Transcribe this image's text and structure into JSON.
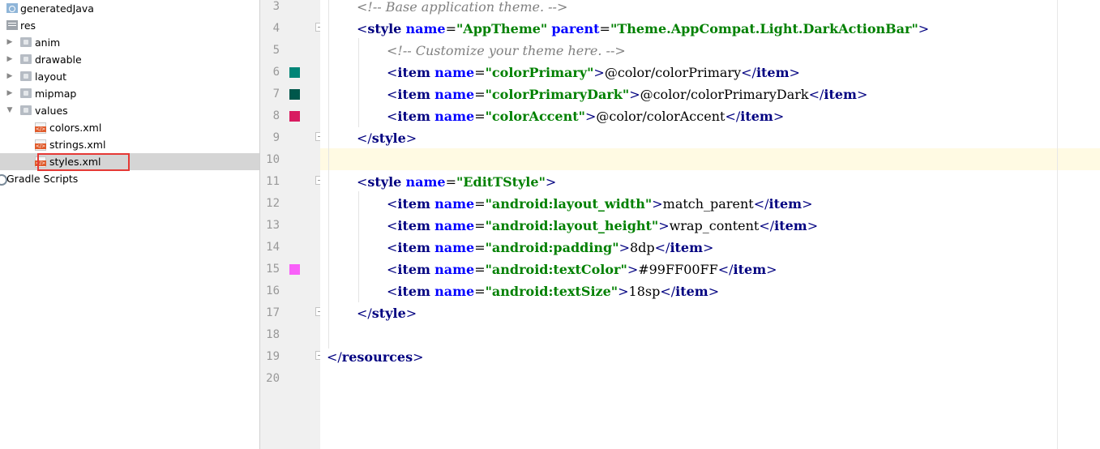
{
  "tree": {
    "items": [
      {
        "label": "generatedJava",
        "icon": "generated-java-icon"
      },
      {
        "label": "res",
        "icon": "res-folder-icon"
      },
      {
        "label": "anim",
        "icon": "folder-icon"
      },
      {
        "label": "drawable",
        "icon": "folder-icon"
      },
      {
        "label": "layout",
        "icon": "folder-icon"
      },
      {
        "label": "mipmap",
        "icon": "folder-icon"
      },
      {
        "label": "values",
        "icon": "folder-icon"
      },
      {
        "label": "colors.xml",
        "icon": "xml-file-icon"
      },
      {
        "label": "strings.xml",
        "icon": "xml-file-icon"
      },
      {
        "label": "styles.xml",
        "icon": "xml-file-icon",
        "selected": true
      },
      {
        "label": "Gradle Scripts",
        "icon": "gradle-icon"
      }
    ]
  },
  "gutter": {
    "line_numbers": [
      "3",
      "4",
      "5",
      "6",
      "7",
      "8",
      "9",
      "10",
      "11",
      "12",
      "13",
      "14",
      "15",
      "16",
      "17",
      "18",
      "19",
      "20"
    ],
    "swatches": [
      {
        "line": "6",
        "color": "#008577"
      },
      {
        "line": "7",
        "color": "#00574B"
      },
      {
        "line": "8",
        "color": "#D81B60"
      },
      {
        "line": "15",
        "color": "#FF00FF",
        "alpha": 0.6
      }
    ]
  },
  "editor": {
    "current_line": "10",
    "colors": {
      "tag": "#000080",
      "attr": "#0000FF",
      "value": "#008000",
      "comment": "#808080"
    },
    "lines": [
      {
        "n": "3",
        "indent": 1,
        "tokens": [
          [
            "cmt",
            "<!-- Base application theme. -->"
          ]
        ]
      },
      {
        "n": "4",
        "indent": 1,
        "tokens": [
          [
            "tag",
            "<"
          ],
          [
            "tname",
            "style"
          ],
          [
            "txt",
            " "
          ],
          [
            "attr",
            "name"
          ],
          [
            "txt",
            "="
          ],
          [
            "val",
            "\"AppTheme\""
          ],
          [
            "txt",
            " "
          ],
          [
            "attr",
            "parent"
          ],
          [
            "txt",
            "="
          ],
          [
            "val",
            "\"Theme.AppCompat.Light.DarkActionBar\""
          ],
          [
            "tag",
            ">"
          ]
        ]
      },
      {
        "n": "5",
        "indent": 2,
        "tokens": [
          [
            "cmt",
            "<!-- Customize your theme here. -->"
          ]
        ]
      },
      {
        "n": "6",
        "indent": 2,
        "tokens": [
          [
            "tag",
            "<"
          ],
          [
            "tname",
            "item"
          ],
          [
            "txt",
            " "
          ],
          [
            "attr",
            "name"
          ],
          [
            "txt",
            "="
          ],
          [
            "val",
            "\"colorPrimary\""
          ],
          [
            "tag",
            ">"
          ],
          [
            "txt",
            "@color/colorPrimary"
          ],
          [
            "tag",
            "</"
          ],
          [
            "tname",
            "item"
          ],
          [
            "tag",
            ">"
          ]
        ]
      },
      {
        "n": "7",
        "indent": 2,
        "tokens": [
          [
            "tag",
            "<"
          ],
          [
            "tname",
            "item"
          ],
          [
            "txt",
            " "
          ],
          [
            "attr",
            "name"
          ],
          [
            "txt",
            "="
          ],
          [
            "val",
            "\"colorPrimaryDark\""
          ],
          [
            "tag",
            ">"
          ],
          [
            "txt",
            "@color/colorPrimaryDark"
          ],
          [
            "tag",
            "</"
          ],
          [
            "tname",
            "item"
          ],
          [
            "tag",
            ">"
          ]
        ]
      },
      {
        "n": "8",
        "indent": 2,
        "tokens": [
          [
            "tag",
            "<"
          ],
          [
            "tname",
            "item"
          ],
          [
            "txt",
            " "
          ],
          [
            "attr",
            "name"
          ],
          [
            "txt",
            "="
          ],
          [
            "val",
            "\"colorAccent\""
          ],
          [
            "tag",
            ">"
          ],
          [
            "txt",
            "@color/colorAccent"
          ],
          [
            "tag",
            "</"
          ],
          [
            "tname",
            "item"
          ],
          [
            "tag",
            ">"
          ]
        ]
      },
      {
        "n": "9",
        "indent": 1,
        "tokens": [
          [
            "tag",
            "</"
          ],
          [
            "tname",
            "style"
          ],
          [
            "tag",
            ">"
          ]
        ]
      },
      {
        "n": "10",
        "indent": 0,
        "tokens": []
      },
      {
        "n": "11",
        "indent": 1,
        "tokens": [
          [
            "tag",
            "<"
          ],
          [
            "tname",
            "style"
          ],
          [
            "txt",
            " "
          ],
          [
            "attr",
            "name"
          ],
          [
            "txt",
            "="
          ],
          [
            "val",
            "\"EditTStyle\""
          ],
          [
            "tag",
            ">"
          ]
        ]
      },
      {
        "n": "12",
        "indent": 2,
        "tokens": [
          [
            "tag",
            "<"
          ],
          [
            "tname",
            "item"
          ],
          [
            "txt",
            " "
          ],
          [
            "attr",
            "name"
          ],
          [
            "txt",
            "="
          ],
          [
            "val",
            "\"android:layout_width\""
          ],
          [
            "tag",
            ">"
          ],
          [
            "txt",
            "match_parent"
          ],
          [
            "tag",
            "</"
          ],
          [
            "tname",
            "item"
          ],
          [
            "tag",
            ">"
          ]
        ]
      },
      {
        "n": "13",
        "indent": 2,
        "tokens": [
          [
            "tag",
            "<"
          ],
          [
            "tname",
            "item"
          ],
          [
            "txt",
            " "
          ],
          [
            "attr",
            "name"
          ],
          [
            "txt",
            "="
          ],
          [
            "val",
            "\"android:layout_height\""
          ],
          [
            "tag",
            ">"
          ],
          [
            "txt",
            "wrap_content"
          ],
          [
            "tag",
            "</"
          ],
          [
            "tname",
            "item"
          ],
          [
            "tag",
            ">"
          ]
        ]
      },
      {
        "n": "14",
        "indent": 2,
        "tokens": [
          [
            "tag",
            "<"
          ],
          [
            "tname",
            "item"
          ],
          [
            "txt",
            " "
          ],
          [
            "attr",
            "name"
          ],
          [
            "txt",
            "="
          ],
          [
            "val",
            "\"android:padding\""
          ],
          [
            "tag",
            ">"
          ],
          [
            "txt",
            "8dp"
          ],
          [
            "tag",
            "</"
          ],
          [
            "tname",
            "item"
          ],
          [
            "tag",
            ">"
          ]
        ]
      },
      {
        "n": "15",
        "indent": 2,
        "tokens": [
          [
            "tag",
            "<"
          ],
          [
            "tname",
            "item"
          ],
          [
            "txt",
            " "
          ],
          [
            "attr",
            "name"
          ],
          [
            "txt",
            "="
          ],
          [
            "val",
            "\"android:textColor\""
          ],
          [
            "tag",
            ">"
          ],
          [
            "txt",
            "#99FF00FF"
          ],
          [
            "tag",
            "</"
          ],
          [
            "tname",
            "item"
          ],
          [
            "tag",
            ">"
          ]
        ]
      },
      {
        "n": "16",
        "indent": 2,
        "tokens": [
          [
            "tag",
            "<"
          ],
          [
            "tname",
            "item"
          ],
          [
            "txt",
            " "
          ],
          [
            "attr",
            "name"
          ],
          [
            "txt",
            "="
          ],
          [
            "val",
            "\"android:textSize\""
          ],
          [
            "tag",
            ">"
          ],
          [
            "txt",
            "18sp"
          ],
          [
            "tag",
            "</"
          ],
          [
            "tname",
            "item"
          ],
          [
            "tag",
            ">"
          ]
        ]
      },
      {
        "n": "17",
        "indent": 1,
        "tokens": [
          [
            "tag",
            "</"
          ],
          [
            "tname",
            "style"
          ],
          [
            "tag",
            ">"
          ]
        ]
      },
      {
        "n": "18",
        "indent": 0,
        "tokens": []
      },
      {
        "n": "19",
        "indent": 0,
        "tokens": [
          [
            "tag",
            "</"
          ],
          [
            "tname",
            "resources"
          ],
          [
            "tag",
            ">"
          ]
        ]
      },
      {
        "n": "20",
        "indent": 0,
        "tokens": []
      }
    ]
  }
}
